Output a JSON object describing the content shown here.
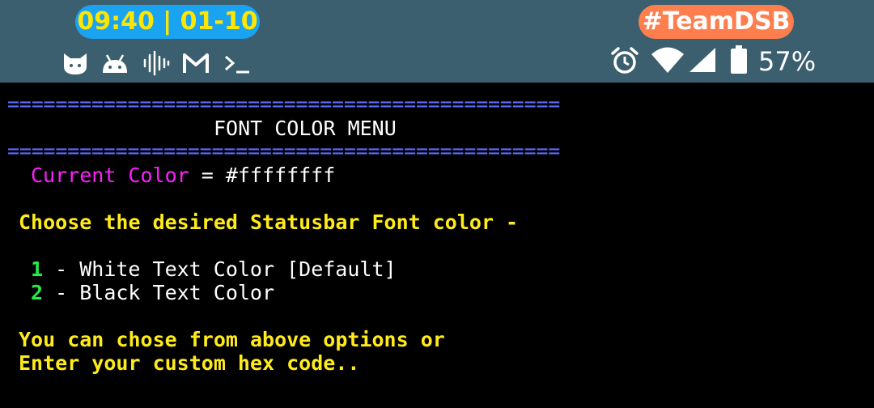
{
  "status_bar": {
    "time_date": "09:40 | 01-10",
    "tag": "#TeamDSB",
    "battery_percent": "57%",
    "colors": {
      "background": "#3b5f6e",
      "time_pill": "#1aa3f0",
      "time_text": "#ffe600",
      "tag_pill": "#ff7e4d"
    },
    "left_icons": [
      "cat-face-icon",
      "android-icon",
      "sound-wave-icon",
      "gmail-icon",
      "terminal-prompt-icon"
    ],
    "right_icons": [
      "alarm-icon",
      "wifi-icon",
      "cell-signal-icon",
      "battery-icon"
    ]
  },
  "terminal": {
    "separator_top": "==============================================",
    "title": "FONT COLOR MENU",
    "separator_bottom": "==============================================",
    "current_label": "Current Color",
    "current_eq": " = ",
    "current_value": "#ffffffff",
    "prompt": "Choose the desired Statusbar Font color -",
    "options": [
      {
        "number": "1",
        "text": " - White Text Color [Default]"
      },
      {
        "number": "2",
        "text": " - Black Text Color"
      }
    ],
    "footer_line1": "You can chose from above options or",
    "footer_line2": "Enter your custom hex code.."
  }
}
